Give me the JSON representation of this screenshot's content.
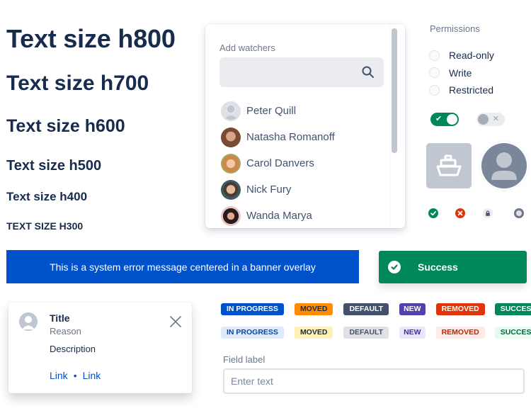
{
  "headings": {
    "h800": "Text size h800",
    "h700": "Text size h700",
    "h600": "Text size h600",
    "h500": "Text size h500",
    "h400": "Text size h400",
    "h300": "Text size h300"
  },
  "watchers": {
    "label": "Add watchers",
    "search_placeholder": "",
    "search_icon": "search-icon",
    "people": [
      {
        "name": "Peter Quill",
        "avatar": "default-avatar"
      },
      {
        "name": "Natasha Romanoff",
        "avatar": "photo"
      },
      {
        "name": "Carol Danvers",
        "avatar": "photo"
      },
      {
        "name": "Nick Fury",
        "avatar": "photo"
      },
      {
        "name": "Wanda Marya",
        "avatar": "photo"
      }
    ]
  },
  "permissions": {
    "title": "Permissions",
    "options": [
      "Read-only",
      "Write",
      "Restricted"
    ],
    "selected": null
  },
  "toggles": [
    {
      "state": "on",
      "icon": "check-icon",
      "glyph": "✔"
    },
    {
      "state": "off",
      "icon": "cross-icon",
      "glyph": "✕"
    }
  ],
  "avatars": {
    "project_icon": "ship-icon",
    "user_icon": "person-icon"
  },
  "status_icons": [
    {
      "name": "success",
      "color": "#00875a"
    },
    {
      "name": "error",
      "color": "#de350b"
    },
    {
      "name": "locked",
      "color": "#42526e"
    },
    {
      "name": "offline",
      "color": "#6b778c"
    }
  ],
  "error_banner": {
    "text": "This is a system error message centered in a banner overlay",
    "color": "#0052cc"
  },
  "success_flag": {
    "text": "Success",
    "color": "#00875a"
  },
  "flag": {
    "title": "Title",
    "reason": "Reason",
    "description": "Description",
    "links": [
      "Link",
      "Link"
    ],
    "separator": "•"
  },
  "lozenges": {
    "bold": [
      {
        "label": "In progress",
        "bg": "#0052cc",
        "fg": "#ffffff"
      },
      {
        "label": "Moved",
        "bg": "#ff8b00",
        "fg": "#172b4d"
      },
      {
        "label": "Default",
        "bg": "#42526e",
        "fg": "#ffffff"
      },
      {
        "label": "New",
        "bg": "#5243aa",
        "fg": "#ffffff"
      },
      {
        "label": "Removed",
        "bg": "#de350b",
        "fg": "#ffffff"
      },
      {
        "label": "Success",
        "bg": "#00875a",
        "fg": "#ffffff"
      }
    ],
    "subtle": [
      {
        "label": "In progress",
        "bg": "#deebff",
        "fg": "#0747a6"
      },
      {
        "label": "Moved",
        "bg": "#fff0b3",
        "fg": "#172b4d"
      },
      {
        "label": "Default",
        "bg": "#dfe1e6",
        "fg": "#42526e"
      },
      {
        "label": "New",
        "bg": "#eae6ff",
        "fg": "#403294"
      },
      {
        "label": "Removed",
        "bg": "#ffebe6",
        "fg": "#bf2600"
      },
      {
        "label": "Success",
        "bg": "#e3fcef",
        "fg": "#006644"
      }
    ]
  },
  "field": {
    "label": "Field label",
    "placeholder": "Enter text",
    "value": ""
  }
}
